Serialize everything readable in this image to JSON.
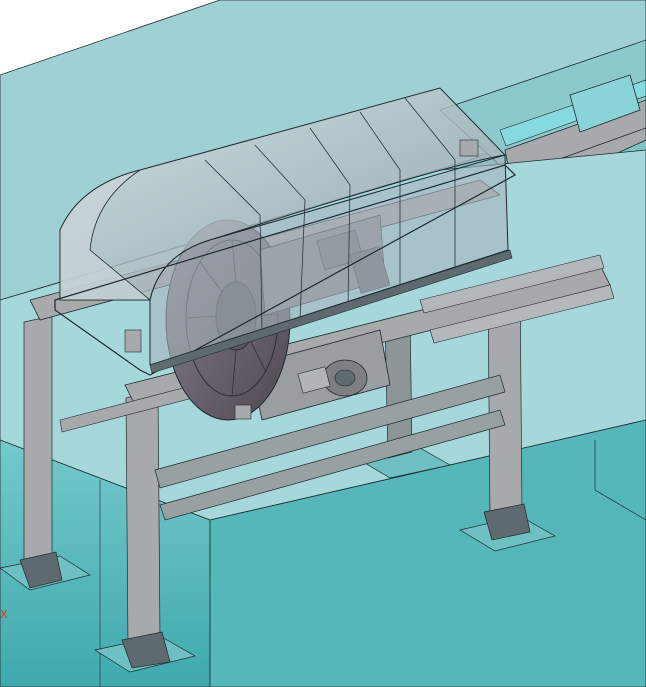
{
  "viewport": {
    "axis_label": "X"
  },
  "colors": {
    "background": "#7fc3c6",
    "sky_plane": "#bfe3e5",
    "platform_top": "#a6d8db",
    "water_front": "#4fb6ba",
    "rail_highlight": "#86d9df",
    "steel": "#a7a9ad",
    "steel_dark": "#5e6a70",
    "enclosure_glass": "#b9c7cc",
    "drum": "#6d6670",
    "edge": "#1e2a2e",
    "axis_label": "#e03030"
  }
}
